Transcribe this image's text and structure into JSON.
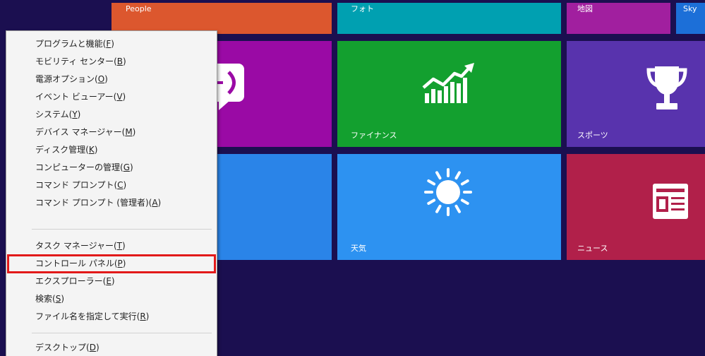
{
  "screen": {
    "background": "#1b0f50"
  },
  "tiles": {
    "people": {
      "label": "People",
      "color": "#dc572e"
    },
    "photos": {
      "label": "フォト",
      "color": "#00a0b1"
    },
    "maps": {
      "label": "地図",
      "color": "#a11f9f"
    },
    "sky": {
      "label": "Sky",
      "color": "#1c6fd8"
    },
    "messaging": {
      "icon": "speech-bubble-icon",
      "color": "#9a0aa5"
    },
    "finance": {
      "label": "ファイナンス",
      "icon": "chart-icon",
      "color": "#13a02f"
    },
    "sports": {
      "label": "スポーツ",
      "icon": "trophy-icon",
      "color": "#5833ad"
    },
    "blue": {
      "color": "#2a84e8"
    },
    "weather": {
      "label": "天気",
      "icon": "sun-icon",
      "color": "#2d92f1"
    },
    "news": {
      "label": "ニュース",
      "icon": "news-icon",
      "color": "#b1204a"
    }
  },
  "menu": {
    "highlight_color": "#e21a1a",
    "items": [
      {
        "text": "プログラムと機能(F)"
      },
      {
        "text": "モビリティ センター(B)"
      },
      {
        "text": "電源オプション(O)"
      },
      {
        "text": "イベント ビューアー(V)"
      },
      {
        "text": "システム(Y)"
      },
      {
        "text": "デバイス マネージャー(M)"
      },
      {
        "text": "ディスク管理(K)"
      },
      {
        "text": "コンピューターの管理(G)"
      },
      {
        "text": "コマンド プロンプト(C)"
      },
      {
        "text": "コマンド プロンプト (管理者)(A)"
      },
      {
        "text": "タスク マネージャー(T)"
      },
      {
        "text": "コントロール パネル(P)",
        "highlighted": true
      },
      {
        "text": "エクスプローラー(E)"
      },
      {
        "text": "検索(S)"
      },
      {
        "text": "ファイル名を指定して実行(R)"
      },
      {
        "text": "デスクトップ(D)"
      }
    ]
  }
}
